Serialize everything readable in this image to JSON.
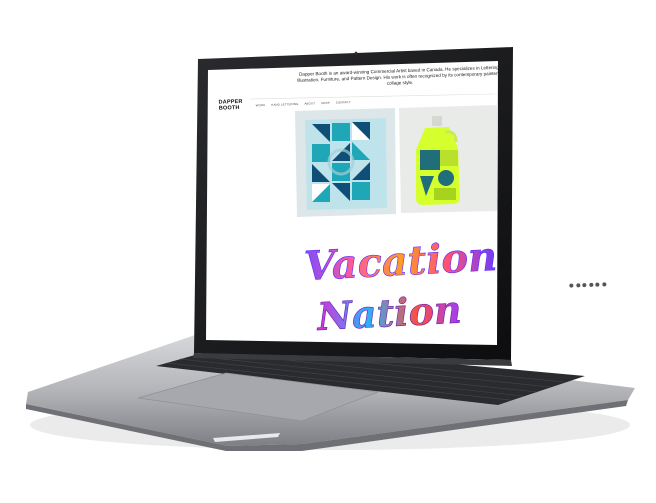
{
  "site": {
    "logo_line1": "DAPPER",
    "logo_line2": "BOOTH",
    "intro": "Dapper Booth is an award-winning Commercial Artist based in Canada. He specializes in Lettering, Illustration, Furniture, and Pattern Design. His work is often recognized by its contemporary painterly-collage style.",
    "nav": [
      "WORK",
      "HAND LETTERING",
      "ABOUT",
      "SHOP",
      "CONTACT"
    ],
    "hero_text_line1": "Vacation",
    "hero_text_line2": "Nation",
    "social_icons": [
      "instagram-icon",
      "dribbble-icon",
      "behance-icon",
      "facebook-icon",
      "pinterest-icon",
      "twitter-icon"
    ]
  },
  "colors": {
    "tile_dark": "#0f4e77",
    "tile_teal": "#1fa7b7",
    "tile_light": "#bfe3ea",
    "bottle_lime": "#d6ff2e",
    "laptop_body": "#b8b9bd",
    "bezel": "#0b0b0c"
  }
}
